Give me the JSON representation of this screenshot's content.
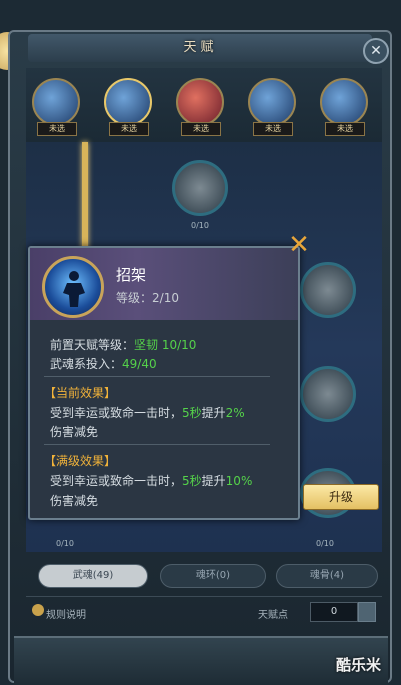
{
  "window": {
    "title": "天赋"
  },
  "talent_tabs": [
    {
      "label": "未选"
    },
    {
      "label": "未选"
    },
    {
      "label": "未选"
    },
    {
      "label": "未选"
    },
    {
      "label": "未选"
    }
  ],
  "tree_nodes": [
    {
      "label": "0/10"
    },
    {
      "label": "0/10"
    },
    {
      "label": "0/10"
    },
    {
      "label": "0/10"
    },
    {
      "label": "0/10"
    }
  ],
  "popup": {
    "skill_name": "招架",
    "level_label": "等级：",
    "level_value": "2/10",
    "prereq_label": "前置天赋等级：",
    "prereq_value": "坚韧 10/10",
    "invest_label": "武魂系投入：",
    "invest_value": "49/40",
    "current_title": "【当前效果】",
    "current_text_1": "受到幸运或致命一击时，",
    "current_seconds": "5秒",
    "current_mid": "提升",
    "current_percent": "2%",
    "current_text_2": "伤害减免",
    "max_title": "【满级效果】",
    "max_text_1": "受到幸运或致命一击时，",
    "max_seconds": "5秒",
    "max_mid": "提升",
    "max_percent": "10%",
    "max_text_2": "伤害减免",
    "upgrade_label": "升级"
  },
  "bottom_tabs": [
    {
      "label": "武魂(49)"
    },
    {
      "label": "魂环(0)"
    },
    {
      "label": "魂骨(4)"
    }
  ],
  "footer": {
    "rules_label": "规则说明",
    "points_label": "天赋点",
    "points_value": "0"
  },
  "watermark": "酷乐米",
  "colors": {
    "green": "#55d24a",
    "orange": "#f0b23a",
    "gold": "#e4c063"
  }
}
